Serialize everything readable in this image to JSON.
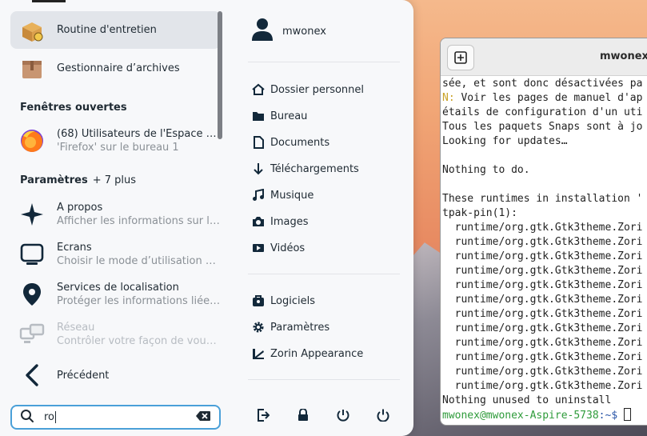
{
  "left": {
    "apps": [
      {
        "label": "Routine d'entretien",
        "icon": "package-tool-icon"
      },
      {
        "label": "Gestionnaire d’archives",
        "icon": "archive-box-icon"
      }
    ],
    "windows_header": "Fenêtres ouvertes",
    "windows": [
      {
        "title": "(68) Utilisateurs de l'Espace éc…",
        "subtitle": "'Firefox' sur le bureau 1"
      }
    ],
    "settings_header": "Paramètres",
    "settings_more": "+ 7 plus",
    "settings": [
      {
        "title": "À propos",
        "subtitle": "Afficher les informations sur le …"
      },
      {
        "title": "Écrans",
        "subtitle": "Choisir le mode d’utilisation de…"
      },
      {
        "title": "Services de localisation",
        "subtitle": "Protéger les informations liées …"
      },
      {
        "title": "Réseau",
        "subtitle": "Contrôler votre façon de vous …"
      }
    ],
    "back_label": "Précédent",
    "search_value": "ro"
  },
  "right": {
    "username": "mwonex",
    "places": [
      "Dossier personnel",
      "Bureau",
      "Documents",
      "Téléchargements",
      "Musique",
      "Images",
      "Vidéos"
    ],
    "tools": [
      "Logiciels",
      "Paramètres",
      "Zorin Appearance"
    ]
  },
  "terminal": {
    "title": "mwonex@",
    "lines": [
      "sée, et sont donc désactivées pa",
      "N: Voir les pages de manuel d'ap",
      "étails de configuration d'un uti",
      "Tous les paquets Snaps sont à jo",
      "Looking for updates…",
      "",
      "Nothing to do.",
      "",
      "These runtimes in installation '",
      "tpak-pin(1):",
      "  runtime/org.gtk.Gtk3theme.Zori",
      "  runtime/org.gtk.Gtk3theme.Zori",
      "  runtime/org.gtk.Gtk3theme.Zori",
      "  runtime/org.gtk.Gtk3theme.Zori",
      "  runtime/org.gtk.Gtk3theme.Zori",
      "  runtime/org.gtk.Gtk3theme.Zori",
      "  runtime/org.gtk.Gtk3theme.Zori",
      "  runtime/org.gtk.Gtk3theme.Zori",
      "  runtime/org.gtk.Gtk3theme.Zori",
      "  runtime/org.gtk.Gtk3theme.Zori",
      "  runtime/org.gtk.Gtk3theme.Zori",
      "  runtime/org.gtk.Gtk3theme.Zori",
      "Nothing unused to uninstall"
    ],
    "prompt_user": "mwonex@mwonex-Aspire-5738",
    "prompt_suffix": ":~$ "
  },
  "colors": {
    "accent": "#4aa0d8",
    "prompt_green": "#2e9b3a",
    "prompt_blue": "#2b57a8"
  }
}
